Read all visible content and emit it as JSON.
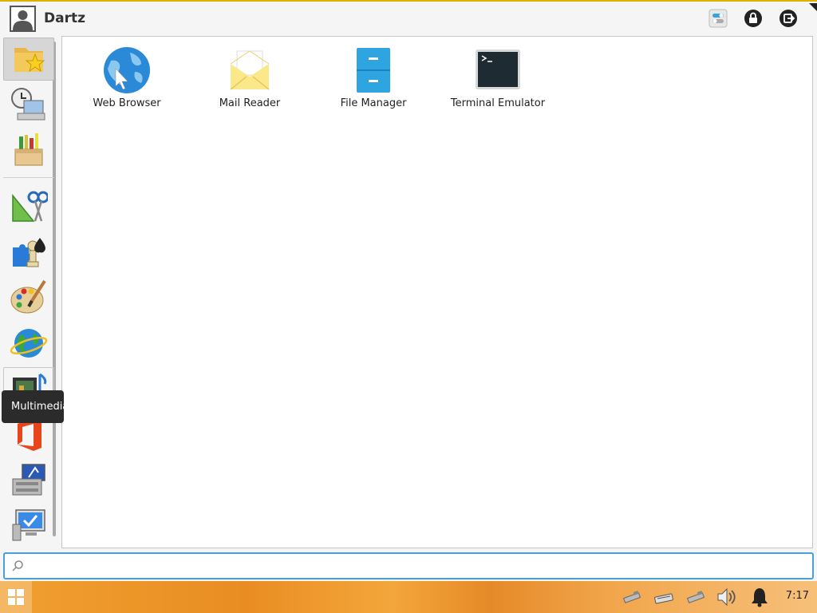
{
  "header": {
    "user_name": "Dartz",
    "icons": [
      "settings-toggle-icon",
      "lock-icon",
      "logout-icon"
    ]
  },
  "sidebar": {
    "categories": [
      {
        "name": "favorites",
        "icon": "favorites-folder-icon",
        "active": true
      },
      {
        "name": "recently-used",
        "icon": "clock-computer-icon"
      },
      {
        "name": "all-applications",
        "icon": "applications-box-icon"
      },
      {
        "name": "accessories",
        "icon": "accessories-scissors-icon"
      },
      {
        "name": "games",
        "icon": "games-puzzle-icon"
      },
      {
        "name": "graphics",
        "icon": "graphics-palette-icon"
      },
      {
        "name": "internet",
        "icon": "internet-globe-icon"
      },
      {
        "name": "multimedia",
        "icon": "multimedia-film-icon",
        "hover": true
      },
      {
        "name": "office",
        "icon": "office-logo-icon"
      },
      {
        "name": "settings",
        "icon": "settings-computer-icon"
      },
      {
        "name": "system",
        "icon": "system-monitor-icon"
      }
    ],
    "tooltip": "Multimedia"
  },
  "apps": [
    {
      "label": "Web Browser",
      "icon": "web-browser-globe-icon"
    },
    {
      "label": "Mail Reader",
      "icon": "mail-envelope-icon"
    },
    {
      "label": "File Manager",
      "icon": "file-cabinet-icon"
    },
    {
      "label": "Terminal Emulator",
      "icon": "terminal-icon"
    }
  ],
  "search": {
    "value": "",
    "placeholder": ""
  },
  "taskbar": {
    "clock": "7:17",
    "tray_icons": [
      "network-icon",
      "keyboard-icon",
      "network-icon-2",
      "volume-icon",
      "notification-bell-icon"
    ]
  },
  "colors": {
    "accent": "#4a9fd8",
    "header_border": "#e0b000"
  }
}
